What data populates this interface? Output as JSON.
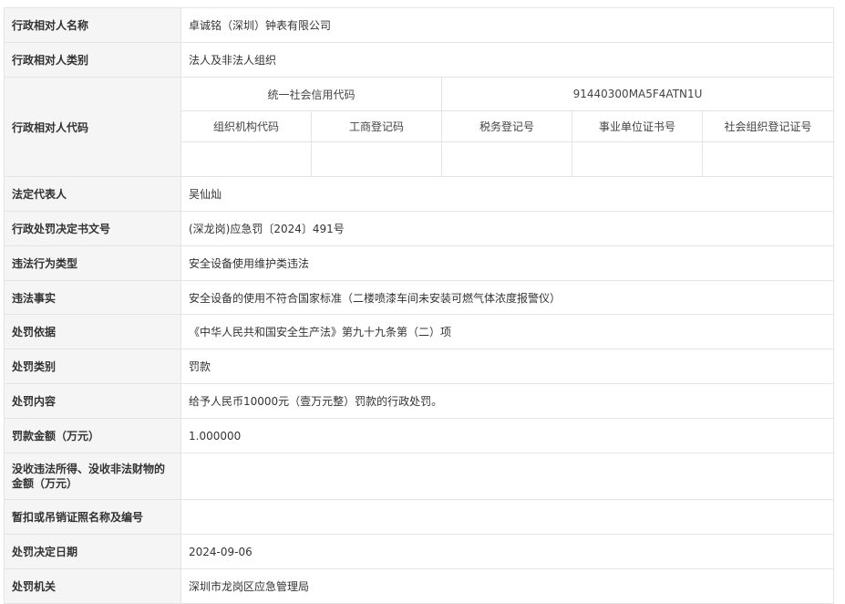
{
  "rows": {
    "name": {
      "label": "行政相对人名称",
      "value": "卓诚铭（深圳）钟表有限公司"
    },
    "category": {
      "label": "行政相对人类别",
      "value": "法人及非法人组织"
    },
    "code": {
      "label": "行政相对人代码",
      "credit_code_label": "统一社会信用代码",
      "credit_code_value": "91440300MA5F4ATN1U",
      "sub_headers": [
        "组织机构代码",
        "工商登记码",
        "税务登记号",
        "事业单位证书号",
        "社会组织登记证号"
      ]
    },
    "legal_rep": {
      "label": "法定代表人",
      "value": "吴仙灿"
    },
    "doc_no": {
      "label": "行政处罚决定书文号",
      "value": "(深龙岗)应急罚〔2024〕491号"
    },
    "violation_type": {
      "label": "违法行为类型",
      "value": "安全设备使用维护类违法"
    },
    "violation_fact": {
      "label": "违法事实",
      "value": "安全设备的使用不符合国家标准（二楼喷漆车间未安装可燃气体浓度报警仪）"
    },
    "basis": {
      "label": "处罚依据",
      "value": "《中华人民共和国安全生产法》第九十九条第（二）项"
    },
    "penalty_category": {
      "label": "处罚类别",
      "value": "罚款"
    },
    "penalty_content": {
      "label": "处罚内容",
      "value": "给予人民币10000元（壹万元整）罚款的行政处罚。"
    },
    "fine_amount": {
      "label": "罚款金额（万元）",
      "value": "1.000000"
    },
    "confiscation": {
      "label": "没收违法所得、没收非法财物的金额（万元）",
      "value": ""
    },
    "license": {
      "label": "暂扣或吊销证照名称及编号",
      "value": ""
    },
    "decision_date": {
      "label": "处罚决定日期",
      "value": "2024-09-06"
    },
    "authority": {
      "label": "处罚机关",
      "value": "深圳市龙岗区应急管理局"
    }
  }
}
